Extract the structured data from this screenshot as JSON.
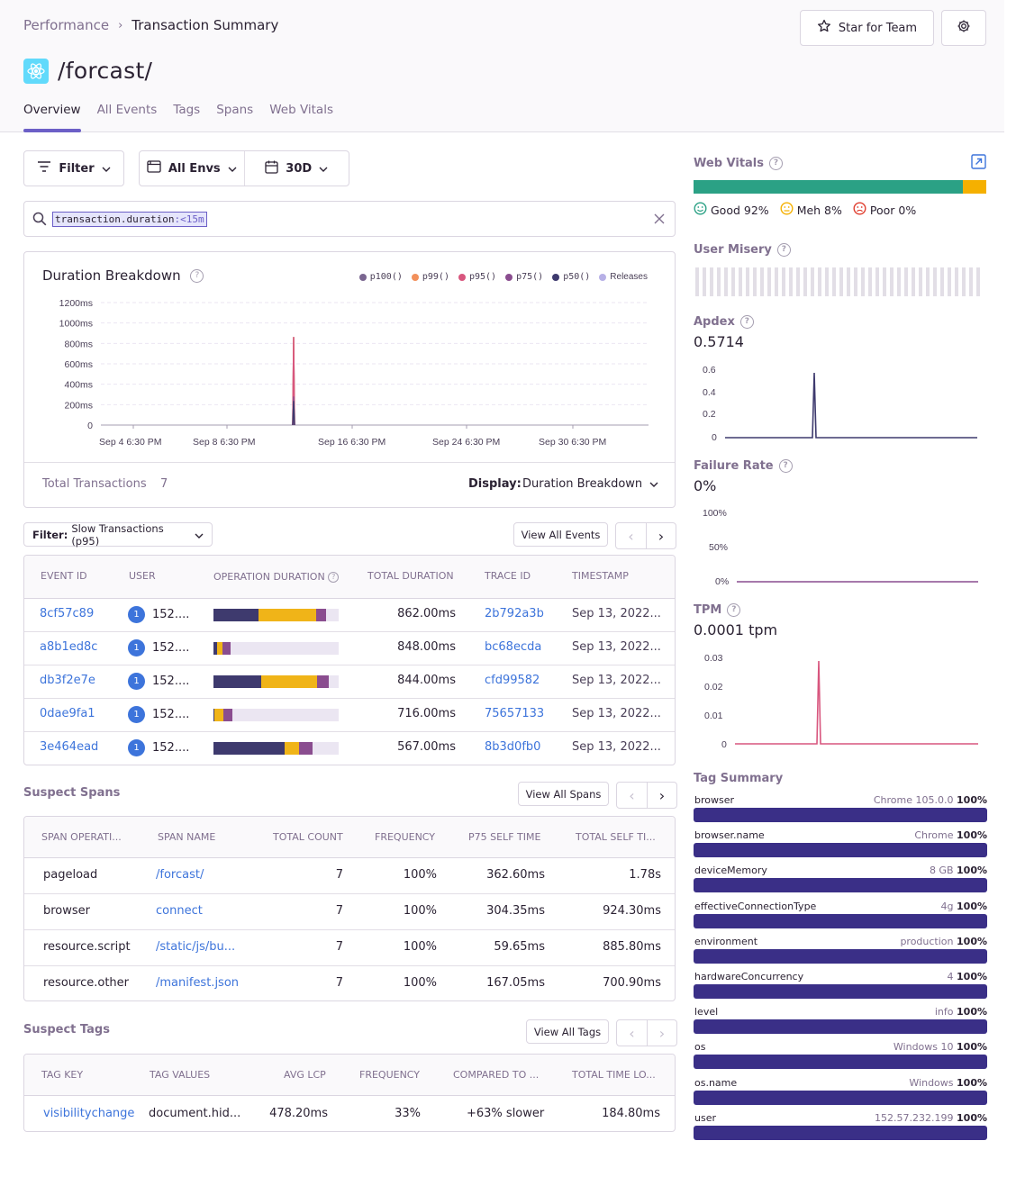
{
  "breadcrumb": {
    "parent": "Performance",
    "current": "Transaction Summary"
  },
  "header": {
    "title": "/forcast/",
    "star_label": "Star for Team"
  },
  "tabs": [
    "Overview",
    "All Events",
    "Tags",
    "Spans",
    "Web Vitals"
  ],
  "filters": {
    "filter_label": "Filter",
    "env_label": "All Envs",
    "period_label": "30D"
  },
  "search": {
    "key": "transaction.duration",
    "op": ":<15m"
  },
  "duration_chart": {
    "title": "Duration Breakdown",
    "legend": [
      {
        "name": "p100()",
        "color": "#7a6690"
      },
      {
        "name": "p99()",
        "color": "#f2905b"
      },
      {
        "name": "p95()",
        "color": "#d8567e"
      },
      {
        "name": "p75()",
        "color": "#8a4d8f"
      },
      {
        "name": "p50()",
        "color": "#3e3a6e"
      },
      {
        "name": "Releases",
        "color": "#b7b0e6"
      }
    ],
    "y_ticks": [
      "1200ms",
      "1000ms",
      "800ms",
      "600ms",
      "400ms",
      "200ms",
      "0"
    ],
    "x_ticks": [
      "Sep 4 6:30 PM",
      "Sep 8 6:30 PM",
      "Sep 16 6:30 PM",
      "Sep 24 6:30 PM",
      "Sep 30 6:30 PM"
    ],
    "total_label": "Total Transactions",
    "total_value": "7",
    "display_label": "Display:",
    "display_value": "Duration Breakdown"
  },
  "chart_data": [
    {
      "type": "line",
      "title": "Duration Breakdown",
      "ylim": [
        0,
        1200
      ],
      "series": [
        {
          "name": "p100()",
          "spike_value": 862
        },
        {
          "name": "p99()",
          "spike_value": 862
        },
        {
          "name": "p95()",
          "spike_value": 862
        },
        {
          "name": "p75()",
          "spike_value": 848
        },
        {
          "name": "p50()",
          "spike_value": 716
        }
      ]
    },
    {
      "type": "line",
      "title": "Apdex",
      "ylim": [
        0,
        0.6
      ],
      "spike_value": 0.5714
    },
    {
      "type": "line",
      "title": "Failure Rate",
      "ylim": [
        0,
        1
      ],
      "values": [
        0
      ]
    },
    {
      "type": "line",
      "title": "TPM",
      "ylim": [
        0,
        0.03
      ],
      "spike_value": 0.029
    }
  ],
  "events": {
    "filter_label": "Filter:",
    "filter_value": "Slow Transactions (p95)",
    "view_all": "View All Events",
    "columns": [
      "EVENT ID",
      "USER",
      "OPERATION DURATION",
      "TOTAL DURATION",
      "TRACE ID",
      "TIMESTAMP"
    ],
    "rows": [
      {
        "id": "8cf57c89",
        "user": "152....",
        "dur": "862.00ms",
        "trace": "2b792a3b",
        "ts": "Sep 13, 2022...",
        "bar": [
          0.36,
          0.46,
          0.08,
          0.1
        ]
      },
      {
        "id": "a8b1ed8c",
        "user": "152....",
        "dur": "848.00ms",
        "trace": "bc68ecda",
        "ts": "Sep 13, 2022...",
        "bar": [
          0.03,
          0.04,
          0.07,
          0.86
        ]
      },
      {
        "id": "db3f2e7e",
        "user": "152....",
        "dur": "844.00ms",
        "trace": "cfd99582",
        "ts": "Sep 13, 2022...",
        "bar": [
          0.38,
          0.45,
          0.09,
          0.08
        ]
      },
      {
        "id": "0dae9fa1",
        "user": "152....",
        "dur": "716.00ms",
        "trace": "75657133",
        "ts": "Sep 13, 2022...",
        "bar": [
          0.01,
          0.07,
          0.07,
          0.85
        ]
      },
      {
        "id": "3e464ead",
        "user": "152....",
        "dur": "567.00ms",
        "trace": "8b3d0fb0",
        "ts": "Sep 13, 2022...",
        "bar": [
          0.57,
          0.11,
          0.11,
          0.21
        ]
      }
    ]
  },
  "spans": {
    "title": "Suspect Spans",
    "view_all": "View All Spans",
    "columns": [
      "SPAN OPERATI...",
      "SPAN NAME",
      "TOTAL COUNT",
      "FREQUENCY",
      "P75 SELF TIME",
      "TOTAL SELF TI..."
    ],
    "rows": [
      {
        "op": "pageload",
        "name": "/forcast/",
        "count": "7",
        "freq": "100%",
        "p75": "362.60ms",
        "total": "1.78s"
      },
      {
        "op": "browser",
        "name": "connect",
        "count": "7",
        "freq": "100%",
        "p75": "304.35ms",
        "total": "924.30ms"
      },
      {
        "op": "resource.script",
        "name": "/static/js/bu...",
        "count": "7",
        "freq": "100%",
        "p75": "59.65ms",
        "total": "885.80ms"
      },
      {
        "op": "resource.other",
        "name": "/manifest.json",
        "count": "7",
        "freq": "100%",
        "p75": "167.05ms",
        "total": "700.90ms"
      }
    ]
  },
  "tags": {
    "title": "Suspect Tags",
    "view_all": "View All Tags",
    "columns": [
      "TAG KEY",
      "TAG VALUES",
      "AVG LCP",
      "FREQUENCY",
      "COMPARED TO ...",
      "TOTAL TIME LO..."
    ],
    "rows": [
      {
        "key": "visibilitychange",
        "value": "document.hid...",
        "lcp": "478.20ms",
        "freq": "33%",
        "cmp": "+63% slower",
        "total": "184.80ms"
      }
    ]
  },
  "side": {
    "web_vitals": {
      "label": "Web Vitals",
      "good": "Good 92%",
      "meh": "Meh 8%",
      "poor": "Poor 0%",
      "good_frac": 0.92,
      "meh_frac": 0.08
    },
    "user_misery": {
      "label": "User Misery"
    },
    "apdex": {
      "label": "Apdex",
      "value": "0.5714",
      "ticks": [
        "0.6",
        "0.4",
        "0.2",
        "0"
      ]
    },
    "failure_rate": {
      "label": "Failure Rate",
      "value": "0%",
      "ticks": [
        "100%",
        "50%",
        "0%"
      ]
    },
    "tpm": {
      "label": "TPM",
      "value": "0.0001 tpm",
      "ticks": [
        "0.03",
        "0.02",
        "0.01",
        "0"
      ]
    },
    "tag_summary": {
      "label": "Tag Summary",
      "items": [
        {
          "name": "browser",
          "value": "Chrome 105.0.0",
          "pct": "100%"
        },
        {
          "name": "browser.name",
          "value": "Chrome",
          "pct": "100%"
        },
        {
          "name": "deviceMemory",
          "value": "8 GB",
          "pct": "100%"
        },
        {
          "name": "effectiveConnectionType",
          "value": "4g",
          "pct": "100%"
        },
        {
          "name": "environment",
          "value": "production",
          "pct": "100%"
        },
        {
          "name": "hardwareConcurrency",
          "value": "4",
          "pct": "100%"
        },
        {
          "name": "level",
          "value": "info",
          "pct": "100%"
        },
        {
          "name": "os",
          "value": "Windows 10",
          "pct": "100%"
        },
        {
          "name": "os.name",
          "value": "Windows",
          "pct": "100%"
        },
        {
          "name": "user",
          "value": "152.57.232.199",
          "pct": "100%"
        }
      ]
    }
  }
}
